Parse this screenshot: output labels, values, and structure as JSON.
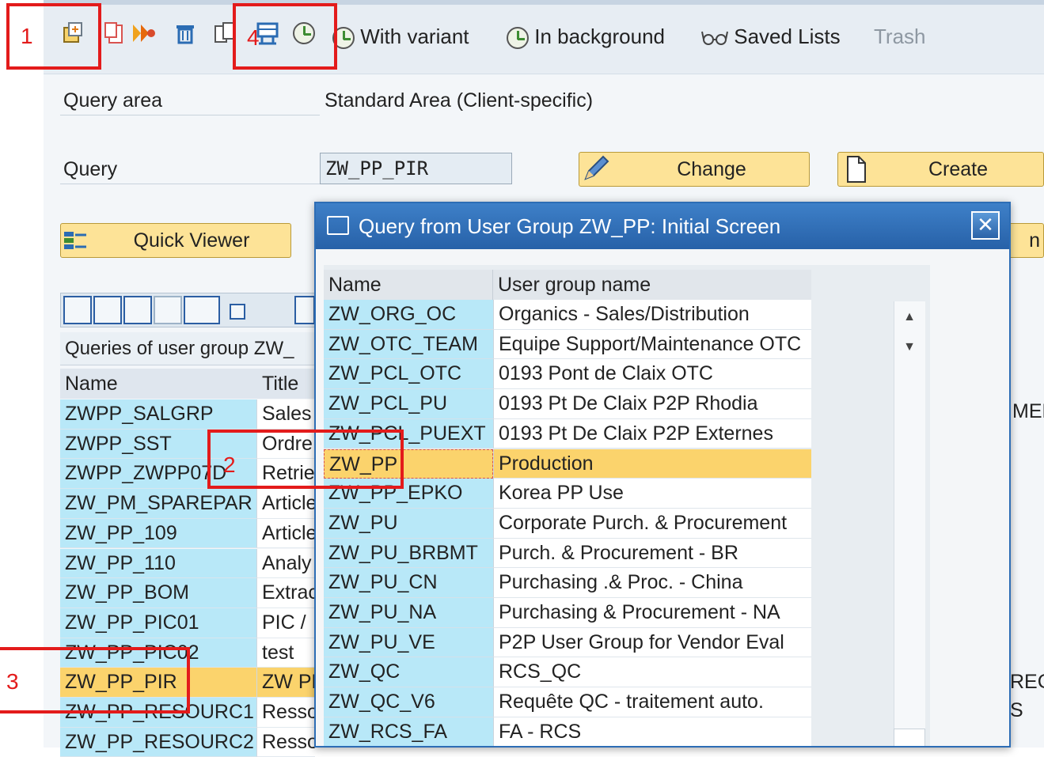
{
  "toolbar": {
    "buttons": [
      {
        "icon": "execute-query-icon"
      },
      {
        "icon": "copy-icon"
      },
      {
        "icon": "forward-icon"
      },
      {
        "icon": "delete-trash-icon"
      },
      {
        "icon": "rename-icon"
      },
      {
        "icon": "other-user-group-icon"
      },
      {
        "icon": "execute-clock-icon"
      }
    ],
    "with_variant": "With variant",
    "in_background": "In background",
    "saved_lists": "Saved Lists",
    "trash": "Trash"
  },
  "form": {
    "query_area_label": "Query area",
    "query_area_value": "Standard Area (Client-specific)",
    "query_label": "Query",
    "query_value": "ZW_PP_PIR",
    "change_button": "Change",
    "create_button": "Create",
    "quick_viewer_button": "Quick Viewer",
    "partial_button_text": "n"
  },
  "query_list": {
    "title": "Queries of user group ZW_",
    "columns": [
      "Name",
      "Title"
    ],
    "rows": [
      {
        "name": "ZWPP_SALGRP",
        "title": "Sales",
        "selected": false
      },
      {
        "name": "ZWPP_SST",
        "title": "Ordre",
        "selected": false
      },
      {
        "name": "ZWPP_ZWPP07D",
        "title": "Retrie",
        "selected": false
      },
      {
        "name": "ZW_PM_SPAREPAR",
        "title": "Article",
        "selected": false
      },
      {
        "name": "ZW_PP_109",
        "title": "Article",
        "selected": false
      },
      {
        "name": "ZW_PP_110",
        "title": "Analy",
        "selected": false
      },
      {
        "name": "ZW_PP_BOM",
        "title": "Extrac",
        "selected": false
      },
      {
        "name": "ZW_PP_PIC01",
        "title": "PIC /",
        "selected": false
      },
      {
        "name": "ZW_PP_PIC02",
        "title": "test",
        "selected": false
      },
      {
        "name": "ZW_PP_PIR",
        "title": "ZW PF",
        "selected": true
      },
      {
        "name": "ZW_PP_RESOURC1",
        "title": "Resso",
        "selected": false
      },
      {
        "name": "ZW_PP_RESOURC2",
        "title": "Resso",
        "selected": false
      }
    ],
    "right_edge_texts": [
      "MEN",
      "REC",
      "S"
    ]
  },
  "dialog": {
    "title": "Query from User Group ZW_PP: Initial Screen",
    "close_label": "✕",
    "columns": [
      "Name",
      "User group name"
    ],
    "rows": [
      {
        "name": "ZW_ORG_OC",
        "group": "Organics - Sales/Distribution",
        "selected": false
      },
      {
        "name": "ZW_OTC_TEAM",
        "group": "Equipe Support/Maintenance OTC",
        "selected": false
      },
      {
        "name": "ZW_PCL_OTC",
        "group": "0193 Pont de Claix OTC",
        "selected": false
      },
      {
        "name": "ZW_PCL_PU",
        "group": "0193 Pt De Claix P2P Rhodia",
        "selected": false
      },
      {
        "name": "ZW_PCL_PUEXT",
        "group": "0193 Pt De Claix P2P Externes",
        "selected": false
      },
      {
        "name": "ZW_PP",
        "group": "Production",
        "selected": true
      },
      {
        "name": "ZW_PP_EPKO",
        "group": "Korea PP Use",
        "selected": false
      },
      {
        "name": "ZW_PU",
        "group": "Corporate Purch. & Procurement",
        "selected": false
      },
      {
        "name": "ZW_PU_BRBMT",
        "group": "Purch. & Procurement - BR",
        "selected": false
      },
      {
        "name": "ZW_PU_CN",
        "group": "Purchasing .& Proc. - China",
        "selected": false
      },
      {
        "name": "ZW_PU_NA",
        "group": "Purchasing & Procurement - NA",
        "selected": false
      },
      {
        "name": "ZW_PU_VE",
        "group": "P2P User Group for Vendor Eval",
        "selected": false
      },
      {
        "name": "ZW_QC",
        "group": "RCS_QC",
        "selected": false
      },
      {
        "name": "ZW_QC_V6",
        "group": "Requête QC - traitement auto.",
        "selected": false
      },
      {
        "name": "ZW_RCS_FA",
        "group": "FA - RCS",
        "selected": false
      }
    ],
    "scroll_up": "▲",
    "scroll_down": "▼"
  },
  "annotations": {
    "marker_1": "1",
    "marker_2": "2",
    "marker_3": "3",
    "marker_4": "4",
    "color": "#e31b1b"
  },
  "colors": {
    "selection": "#fbd36c",
    "key_column": "#b8e8f8",
    "dialog_title": "#2d6db5",
    "button": "#fde397"
  }
}
